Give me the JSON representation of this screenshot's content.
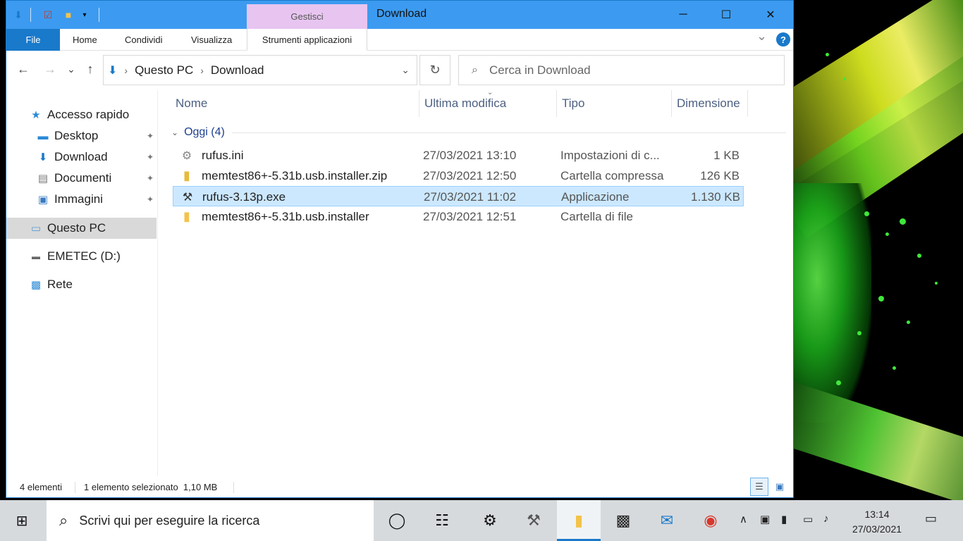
{
  "window": {
    "title": "Download",
    "context_tab": "Gestisci",
    "controls": {
      "minimize": "─",
      "maximize": "☐",
      "close": "✕"
    }
  },
  "quick_access_toolbar": {
    "icons": [
      "download-arrow-icon",
      "properties-icon",
      "new-folder-icon",
      "customize-chevron-icon"
    ]
  },
  "ribbon": {
    "tabs": [
      "File",
      "Home",
      "Condividi",
      "Visualizza",
      "Strumenti applicazioni"
    ],
    "expand_icon": "⌄",
    "help": "?"
  },
  "navigation": {
    "back": "←",
    "forward": "→",
    "recent": "⌄",
    "up": "↑",
    "breadcrumb": [
      "Questo PC",
      "Download"
    ],
    "refresh": "↻",
    "search_placeholder": "Cerca in Download",
    "search_value": ""
  },
  "sidebar": {
    "items": [
      {
        "label": "Accesso rapido",
        "icon": "star-icon"
      },
      {
        "label": "Desktop",
        "icon": "desktop-icon",
        "pinned": true
      },
      {
        "label": "Download",
        "icon": "download-icon",
        "pinned": true
      },
      {
        "label": "Documenti",
        "icon": "documents-icon",
        "pinned": true
      },
      {
        "label": "Immagini",
        "icon": "pictures-icon",
        "pinned": true
      },
      {
        "label": "Questo PC",
        "icon": "computer-icon",
        "selected": true
      },
      {
        "label": "EMETEC (D:)",
        "icon": "usb-drive-icon"
      },
      {
        "label": "Rete",
        "icon": "network-icon"
      }
    ]
  },
  "columns": [
    "Nome",
    "Ultima modifica",
    "Tipo",
    "Dimensione"
  ],
  "group": {
    "label": "Oggi (4)"
  },
  "files": [
    {
      "name": "rufus.ini",
      "modified": "27/03/2021 13:10",
      "type": "Impostazioni di c...",
      "size": "1 KB",
      "icon": "ini-file-icon"
    },
    {
      "name": "memtest86+-5.31b.usb.installer.zip",
      "modified": "27/03/2021 12:50",
      "type": "Cartella compressa",
      "size": "126 KB",
      "icon": "zip-folder-icon"
    },
    {
      "name": "rufus-3.13p.exe",
      "modified": "27/03/2021 11:02",
      "type": "Applicazione",
      "size": "1.130 KB",
      "icon": "usb-app-icon",
      "selected": true
    },
    {
      "name": "memtest86+-5.31b.usb.installer",
      "modified": "27/03/2021 12:51",
      "type": "Cartella di file",
      "size": "",
      "icon": "folder-icon"
    }
  ],
  "status": {
    "count": "4 elementi",
    "selection": "1 elemento selezionato  1,10 MB"
  },
  "taskbar": {
    "search_placeholder": "Scrivi qui per eseguire la ricerca",
    "clock_time": "13:14",
    "clock_date": "27/03/2021"
  },
  "colors": {
    "accent": "#1979ca",
    "titlebar": "#3c9bf0",
    "context_tab": "#e7c5f0",
    "selection": "#cce8ff"
  }
}
